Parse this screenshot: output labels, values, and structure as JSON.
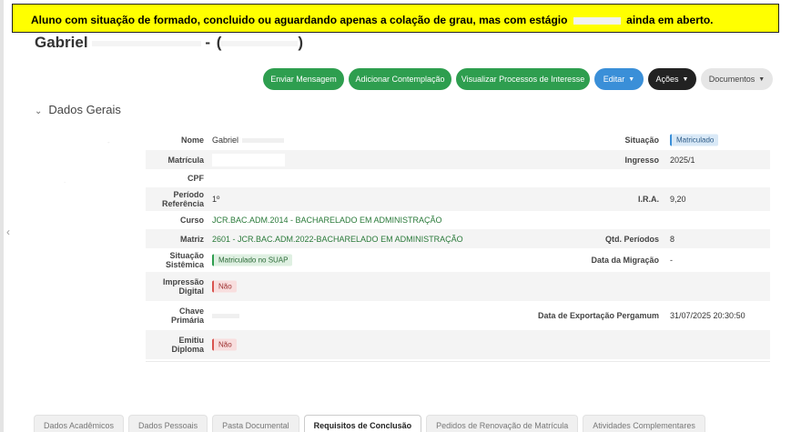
{
  "alert": {
    "text_before": "Aluno com situação de formado, concluido ou aguardando apenas a colação de grau, mas com estágio",
    "text_after": "ainda em aberto."
  },
  "student": {
    "first_name": "Gabriel",
    "separator": "-",
    "open_paren": "(",
    "close_paren": ")"
  },
  "actions": {
    "send_message": "Enviar Mensagem",
    "add_contemplation": "Adicionar Contemplação",
    "view_processes": "Visualizar Processos de Interesse",
    "edit": "Editar",
    "actions": "Ações",
    "documents": "Documentos"
  },
  "section": {
    "title": "Dados Gerais"
  },
  "fields": {
    "nome_label": "Nome",
    "nome_value": "Gabriel",
    "situacao_label": "Situação",
    "situacao_value": "Matriculado",
    "matricula_label": "Matrícula",
    "ingresso_label": "Ingresso",
    "ingresso_value": "2025/1",
    "cpf_label": "CPF",
    "periodo_label_1": "Período",
    "periodo_label_2": "Referência",
    "periodo_value": "1º",
    "ira_label": "I.R.A.",
    "ira_value": "9,20",
    "curso_label": "Curso",
    "curso_value": "JCR.BAC.ADM.2014 - BACHARELADO EM ADMINISTRAÇÃO",
    "matriz_label": "Matriz",
    "matriz_value": "2601 - JCR.BAC.ADM.2022-BACHARELADO EM ADMINISTRAÇÃO",
    "qtd_label": "Qtd. Períodos",
    "qtd_value": "8",
    "sit_sis_label_1": "Situação",
    "sit_sis_label_2": "Sistêmica",
    "sit_sis_value": "Matriculado no SUAP",
    "migracao_label": "Data da Migração",
    "migracao_value": "-",
    "impressao_label_1": "Impressão",
    "impressao_label_2": "Digital",
    "impressao_value": "Não",
    "chave_label_1": "Chave",
    "chave_label_2": "Primária",
    "exportacao_label": "Data de Exportação Pergamum",
    "exportacao_value": "31/07/2025 20:30:50",
    "emitiu_label_1": "Emitiu",
    "emitiu_label_2": "Diploma",
    "emitiu_value": "Não"
  },
  "tabs": [
    {
      "label": "Dados Acadêmicos"
    },
    {
      "label": "Dados Pessoais"
    },
    {
      "label": "Pasta Documental"
    },
    {
      "label": "Requisitos de Conclusão"
    },
    {
      "label": "Pedidos de Renovação de Matrícula"
    },
    {
      "label": "Atividades Complementares"
    }
  ],
  "icons": {
    "collapse": "chevron-down-icon",
    "dropdown": "caret-down-icon",
    "left_nav": "chevron-left-icon"
  }
}
